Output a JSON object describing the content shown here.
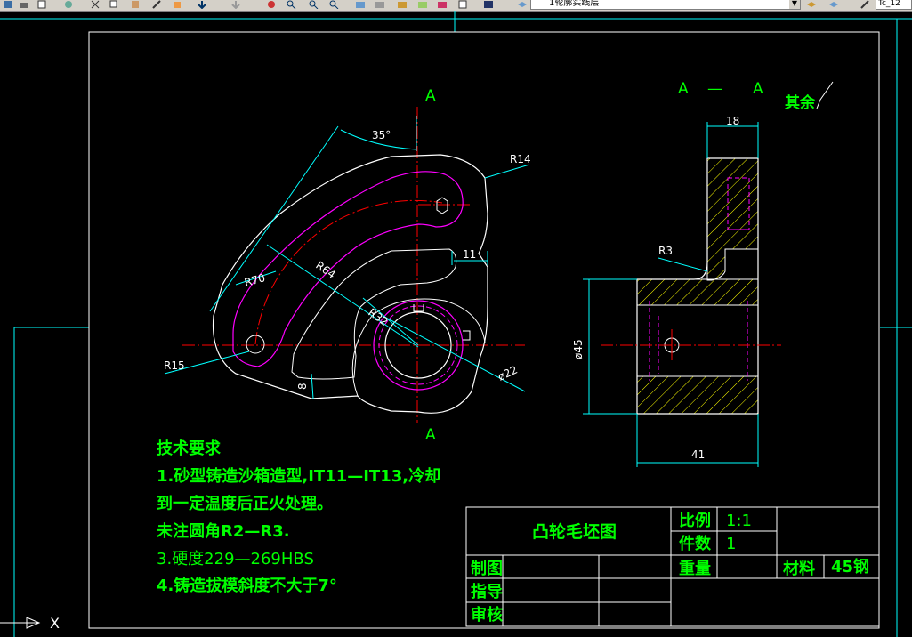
{
  "toolbar": {
    "layer_name": "1轮廓实线层",
    "right_field": "Tc_12"
  },
  "section": {
    "label_top": "A",
    "label_bottom": "A",
    "view_title_left": "A",
    "view_title_dash": "—",
    "view_title_right": "A",
    "roughness_note": "其余"
  },
  "dimensions": {
    "angle": "35°",
    "r14": "R14",
    "r64": "R64",
    "r70": "R70",
    "r32": "R32",
    "r15": "R15",
    "d11": "11",
    "d8": "8",
    "phi22": "ø22",
    "d18": "18",
    "r3": "R3",
    "phi45": "ø45",
    "d41": "41"
  },
  "tech_req": {
    "title": "技术要求",
    "line1": "1.砂型铸造沙箱造型,IT11—IT13,冷却",
    "line2": "到一定温度后正火处理。",
    "line3": "未注圆角R2—R3.",
    "line4": "3.硬度229—269HBS",
    "line5": "4.铸造拔模斜度不大于7°"
  },
  "title_block": {
    "drawing_name": "凸轮毛坯图",
    "scale_label": "比例",
    "scale_value": "1:1",
    "qty_label": "件数",
    "qty_value": "1",
    "weight_label": "重量",
    "material_label": "材料",
    "material_value": "45钢",
    "drawn_label": "制图",
    "guide_label": "指导",
    "review_label": "审核"
  },
  "ucs": {
    "x_label": "X"
  },
  "colors": {
    "outline": "#ffffff",
    "dimension": "#00ffff",
    "centerline": "#ff0000",
    "hidden": "#ff00ff",
    "hatch": "#ffff00",
    "text": "#00ff00",
    "border": "#ffffff",
    "viewport": "#00ffff"
  }
}
